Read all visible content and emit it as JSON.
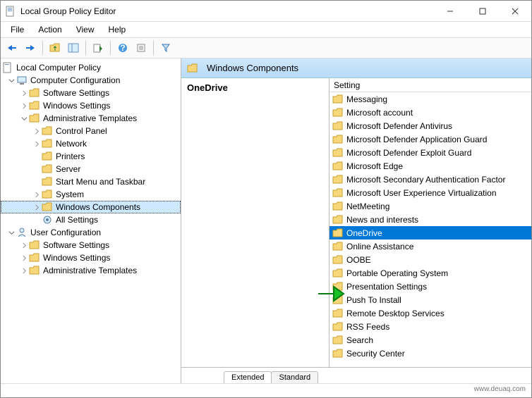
{
  "window": {
    "title": "Local Group Policy Editor"
  },
  "menus": [
    "File",
    "Action",
    "View",
    "Help"
  ],
  "tree": {
    "root": "Local Computer Policy",
    "computer": "Computer Configuration",
    "cc_sw": "Software Settings",
    "cc_win": "Windows Settings",
    "cc_adm": "Administrative Templates",
    "adm_cp": "Control Panel",
    "adm_net": "Network",
    "adm_prn": "Printers",
    "adm_srv": "Server",
    "adm_start": "Start Menu and Taskbar",
    "adm_sys": "System",
    "adm_wc": "Windows Components",
    "adm_all": "All Settings",
    "user": "User Configuration",
    "uc_sw": "Software Settings",
    "uc_win": "Windows Settings",
    "uc_adm": "Administrative Templates"
  },
  "crumb": "Windows Components",
  "desc_heading": "OneDrive",
  "list_header": "Setting",
  "settings": [
    "Messaging",
    "Microsoft account",
    "Microsoft Defender Antivirus",
    "Microsoft Defender Application Guard",
    "Microsoft Defender Exploit Guard",
    "Microsoft Edge",
    "Microsoft Secondary Authentication Factor",
    "Microsoft User Experience Virtualization",
    "NetMeeting",
    "News and interests",
    "OneDrive",
    "Online Assistance",
    "OOBE",
    "Portable Operating System",
    "Presentation Settings",
    "Push To Install",
    "Remote Desktop Services",
    "RSS Feeds",
    "Search",
    "Security Center"
  ],
  "selected_setting": "OneDrive",
  "tabs": {
    "extended": "Extended",
    "standard": "Standard"
  },
  "footer": "www.deuaq.com"
}
